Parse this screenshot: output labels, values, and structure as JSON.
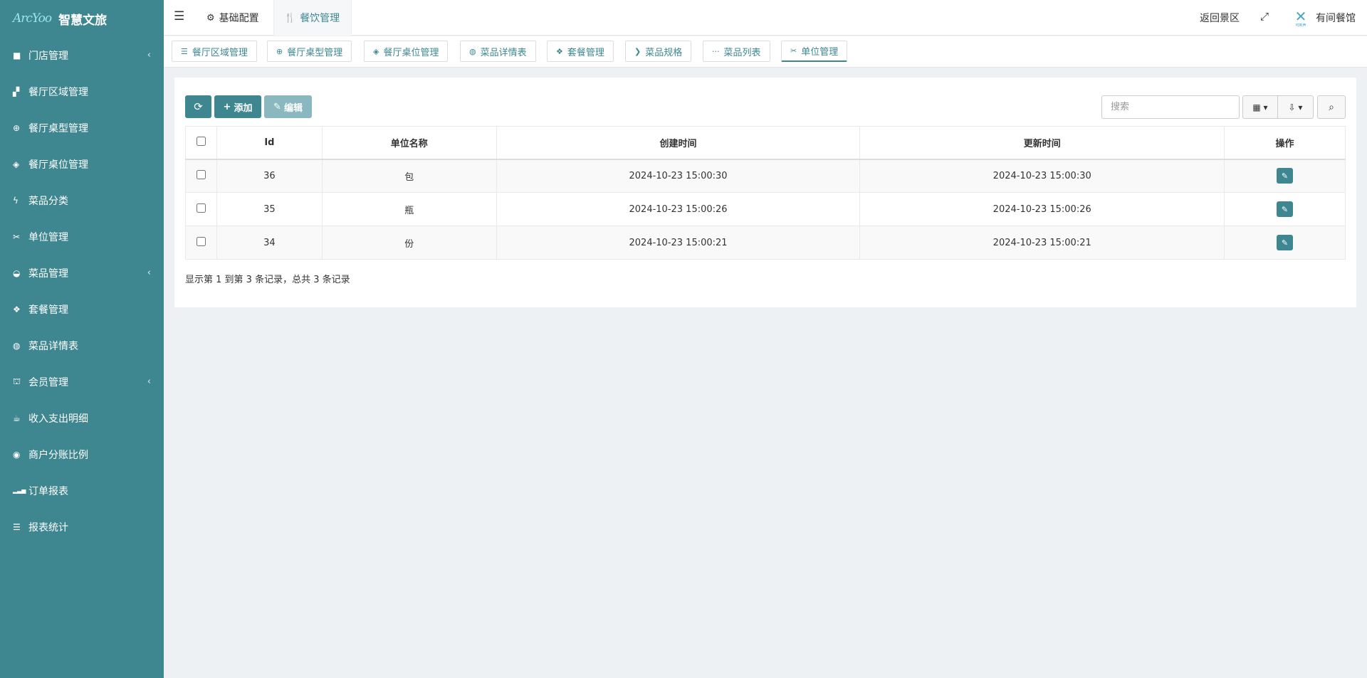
{
  "brand": {
    "logo_mark": "ArcYoo",
    "title": "智慧文旅"
  },
  "sidebar": {
    "items": [
      {
        "label": "门店管理",
        "icon": "folder-icon",
        "glyph": "■",
        "has_children": true
      },
      {
        "label": "餐厅区域管理",
        "icon": "grid-icon",
        "glyph": "▞",
        "has_children": false
      },
      {
        "label": "餐厅桌型管理",
        "icon": "lifebuoy-icon",
        "glyph": "⊕",
        "has_children": false
      },
      {
        "label": "餐厅桌位管理",
        "icon": "cube-icon",
        "glyph": "◈",
        "has_children": false
      },
      {
        "label": "菜品分类",
        "icon": "bolt-icon",
        "glyph": "ϟ",
        "has_children": false
      },
      {
        "label": "单位管理",
        "icon": "unit-icon",
        "glyph": "✂",
        "has_children": false
      },
      {
        "label": "菜品管理",
        "icon": "dashboard-icon",
        "glyph": "◒",
        "has_children": true
      },
      {
        "label": "套餐管理",
        "icon": "dropbox-icon",
        "glyph": "❖",
        "has_children": false
      },
      {
        "label": "菜品详情表",
        "icon": "dribbble-icon",
        "glyph": "◍",
        "has_children": false
      },
      {
        "label": "会员管理",
        "icon": "binoculars-icon",
        "glyph": "⛫",
        "has_children": true
      },
      {
        "label": "收入支出明细",
        "icon": "coffee-icon",
        "glyph": "☕",
        "has_children": false
      },
      {
        "label": "商户分账比例",
        "icon": "compass-icon",
        "glyph": "◉",
        "has_children": false
      },
      {
        "label": "订单报表",
        "icon": "signal-icon",
        "glyph": "▂▃▅",
        "has_children": false
      },
      {
        "label": "报表统计",
        "icon": "sliders-icon",
        "glyph": "☰",
        "has_children": false
      }
    ],
    "caret": "‹"
  },
  "topbar": {
    "menu_glyph": "☰",
    "basic_config": "基础配置",
    "basic_icon": "⚙",
    "food_management": "餐饮管理",
    "food_icon": "🍴",
    "return_link": "返回景区",
    "fullscreen_glyph": "⤢",
    "user_name": "有间餐馆",
    "avatar_mark": "✕",
    "avatar_sub": "可新声"
  },
  "tabs": [
    {
      "label": "餐厅区域管理",
      "icon": "list-icon",
      "glyph": "☰"
    },
    {
      "label": "餐厅桌型管理",
      "icon": "lifebuoy-icon",
      "glyph": "⊕"
    },
    {
      "label": "餐厅桌位管理",
      "icon": "cube-icon",
      "glyph": "◈"
    },
    {
      "label": "菜品详情表",
      "icon": "dribbble-icon",
      "glyph": "◍"
    },
    {
      "label": "套餐管理",
      "icon": "dropbox-icon",
      "glyph": "❖"
    },
    {
      "label": "菜品规格",
      "icon": "chevron-circle-icon",
      "glyph": "❯"
    },
    {
      "label": "菜品列表",
      "icon": "ellipsis-icon",
      "glyph": "···"
    },
    {
      "label": "单位管理",
      "icon": "unit-icon",
      "glyph": "✂"
    }
  ],
  "toolbar": {
    "refresh_glyph": "⟳",
    "add_label": "添加",
    "add_glyph": "+",
    "edit_label": "编辑",
    "edit_glyph": "✎",
    "search_placeholder": "搜索",
    "columns_glyph": "▦ ▾",
    "export_glyph": "⇩ ▾",
    "search_glyph": "⌕"
  },
  "table": {
    "headers": [
      "Id",
      "单位名称",
      "创建时间",
      "更新时间",
      "操作"
    ],
    "rows": [
      {
        "id": "36",
        "name": "包",
        "created": "2024-10-23 15:00:30",
        "updated": "2024-10-23 15:00:30"
      },
      {
        "id": "35",
        "name": "瓶",
        "created": "2024-10-23 15:00:26",
        "updated": "2024-10-23 15:00:26"
      },
      {
        "id": "34",
        "name": "份",
        "created": "2024-10-23 15:00:21",
        "updated": "2024-10-23 15:00:21"
      }
    ],
    "edit_glyph": "✎"
  },
  "pagination": {
    "info": "显示第 1 到第 3 条记录，总共 3 条记录"
  },
  "colors": {
    "sidebar_bg": "#3e8791",
    "accent": "#3e8791",
    "page_bg": "#eef1f4"
  }
}
